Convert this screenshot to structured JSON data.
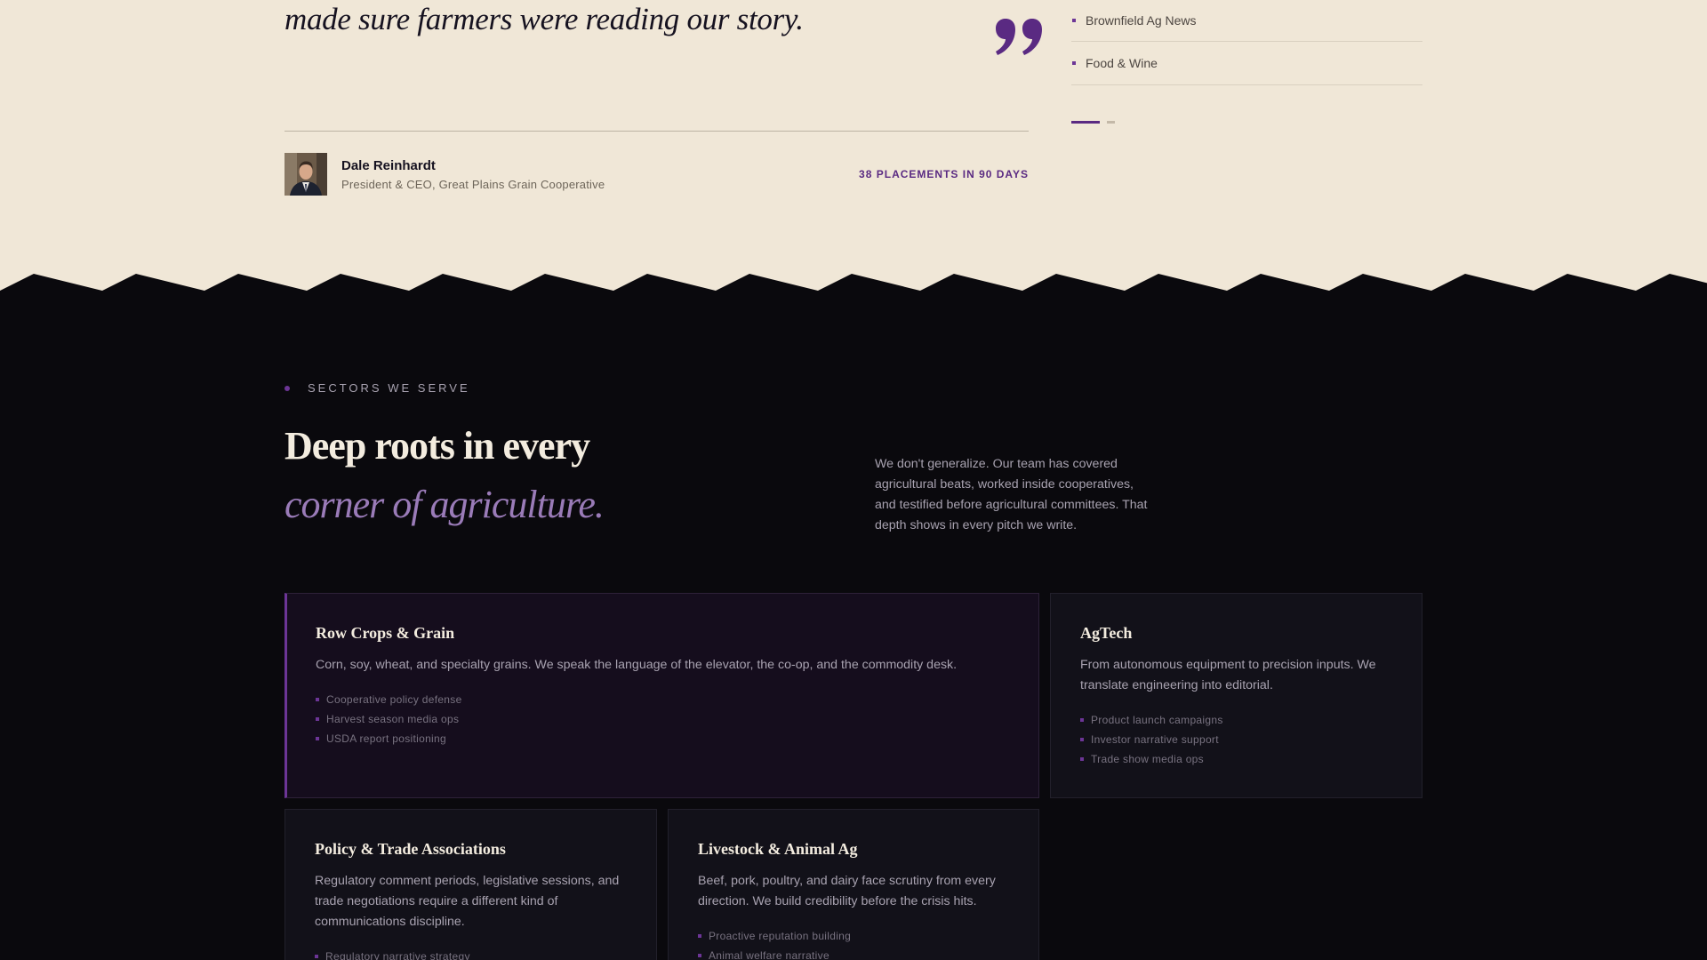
{
  "testimonial": {
    "quote": "made sure farmers were reading our story.",
    "author_name": "Dale Reinhardt",
    "author_title": "President & CEO, Great Plains Grain Cooperative",
    "stat": "38 PLACEMENTS IN 90 DAYS",
    "quote_icon": "closing-quote-icon"
  },
  "publications": [
    {
      "label": "Brownfield Ag News"
    },
    {
      "label": "Food & Wine"
    }
  ],
  "pager": {
    "active": 1,
    "total": 2
  },
  "sectors": {
    "eyebrow": "SECTORS WE SERVE",
    "heading_line1": "Deep roots in every",
    "heading_line2": "corner of agriculture.",
    "intro": "We don't generalize. Our team has covered agricultural beats, worked inside cooperatives, and testified before agricultural committees. That depth shows in every pitch we write.",
    "cards": [
      {
        "title": "Row Crops & Grain",
        "desc": "Corn, soy, wheat, and specialty grains. We speak the language of the elevator, the co-op, and the commodity desk.",
        "items": [
          "Cooperative policy defense",
          "Harvest season media ops",
          "USDA report positioning"
        ]
      },
      {
        "title": "AgTech",
        "desc": "From autonomous equipment to precision inputs. We translate engineering into editorial.",
        "items": [
          "Product launch campaigns",
          "Investor narrative support",
          "Trade show media ops"
        ]
      },
      {
        "title": "Policy & Trade Associations",
        "desc": "Regulatory comment periods, legislative sessions, and trade negotiations require a different kind of communications discipline.",
        "items": [
          "Regulatory narrative strategy"
        ]
      },
      {
        "title": "Livestock & Animal Ag",
        "desc": "Beef, pork, poultry, and dairy face scrutiny from every direction. We build credibility before the crisis hits.",
        "items": [
          "Proactive reputation building",
          "Animal welfare narrative"
        ]
      }
    ]
  },
  "colors": {
    "cream": "#f0e7d7",
    "dark": "#0a090d",
    "accent_purple": "#5a2a82",
    "heading_cream": "#f3ecdf",
    "italic_lavender": "#9a7bb8"
  }
}
